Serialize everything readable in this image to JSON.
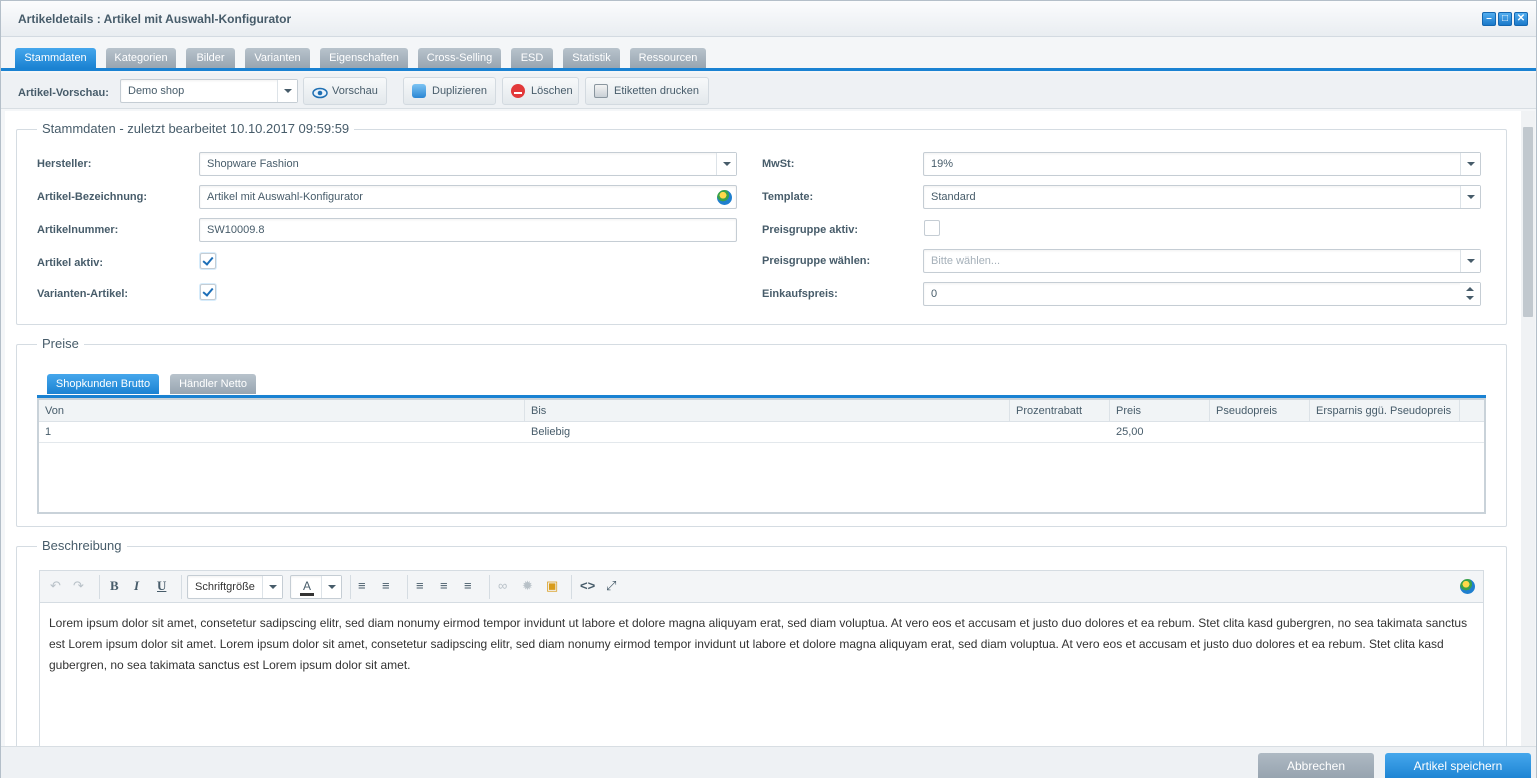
{
  "window": {
    "title": "Artikeldetails : Artikel mit Auswahl-Konfigurator",
    "controls": [
      "minimize",
      "maximize",
      "close"
    ]
  },
  "tabs": [
    {
      "label": "Stammdaten",
      "active": true
    },
    {
      "label": "Kategorien"
    },
    {
      "label": "Bilder"
    },
    {
      "label": "Varianten"
    },
    {
      "label": "Eigenschaften"
    },
    {
      "label": "Cross-Selling"
    },
    {
      "label": "ESD"
    },
    {
      "label": "Statistik"
    },
    {
      "label": "Ressourcen"
    }
  ],
  "toolbar": {
    "preview_label": "Artikel-Vorschau:",
    "shop_value": "Demo shop",
    "vorschau": "Vorschau",
    "duplizieren": "Duplizieren",
    "loeschen": "Löschen",
    "etiketten": "Etiketten drucken"
  },
  "stammdaten": {
    "legend": "Stammdaten - zuletzt bearbeitet 10.10.2017 09:59:59",
    "hersteller_label": "Hersteller:",
    "hersteller_value": "Shopware Fashion",
    "bezeichnung_label": "Artikel-Bezeichnung:",
    "bezeichnung_value": "Artikel mit Auswahl-Konfigurator",
    "nummer_label": "Artikelnummer:",
    "nummer_value": "SW10009.8",
    "aktiv_label": "Artikel aktiv:",
    "aktiv_checked": true,
    "varianten_label": "Varianten-Artikel:",
    "varianten_checked": true,
    "mwst_label": "MwSt:",
    "mwst_value": "19%",
    "template_label": "Template:",
    "template_value": "Standard",
    "preisgruppe_aktiv_label": "Preisgruppe aktiv:",
    "preisgruppe_aktiv_checked": false,
    "preisgruppe_label": "Preisgruppe wählen:",
    "preisgruppe_placeholder": "Bitte wählen...",
    "einkaufspreis_label": "Einkaufspreis:",
    "einkaufspreis_value": "0"
  },
  "preise": {
    "legend": "Preise",
    "tabs": [
      {
        "label": "Shopkunden Brutto",
        "active": true
      },
      {
        "label": "Händler Netto"
      }
    ],
    "columns": [
      "Von",
      "Bis",
      "Prozentrabatt",
      "Preis",
      "Pseudopreis",
      "Ersparnis ggü. Pseudopreis"
    ],
    "rows": [
      [
        "1",
        "Beliebig",
        "",
        "25,00",
        "",
        ""
      ]
    ]
  },
  "beschreibung": {
    "legend": "Beschreibung",
    "font_size_label": "Schriftgröße",
    "text": "Lorem ipsum dolor sit amet, consetetur sadipscing elitr, sed diam nonumy eirmod tempor invidunt ut labore et dolore magna aliquyam erat, sed diam voluptua. At vero eos et accusam et justo duo dolores et ea rebum. Stet clita kasd gubergren, no sea takimata sanctus est Lorem ipsum dolor sit amet. Lorem ipsum dolor sit amet, consetetur sadipscing elitr, sed diam nonumy eirmod tempor invidunt ut labore et dolore magna aliquyam erat, sed diam voluptua. At vero eos et accusam et justo duo dolores et ea rebum. Stet clita kasd gubergren, no sea takimata sanctus est Lorem ipsum dolor sit amet."
  },
  "footer": {
    "cancel": "Abbrechen",
    "save": "Artikel speichern"
  },
  "colors": {
    "accent": "#1a82d2",
    "tab_inactive": "#a3afba",
    "cancel_button": "#a0abb6"
  }
}
